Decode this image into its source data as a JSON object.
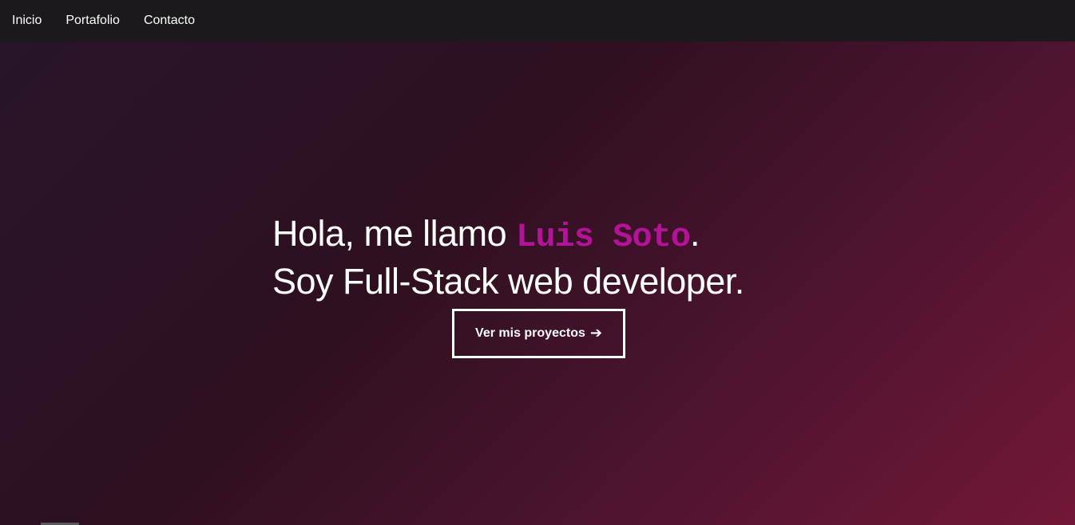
{
  "nav": {
    "items": [
      {
        "label": "Inicio"
      },
      {
        "label": "Portafolio"
      },
      {
        "label": "Contacto"
      }
    ]
  },
  "hero": {
    "line1_prefix": "Hola, me llamo ",
    "name": "Luis Soto",
    "line1_suffix": ".",
    "line2": "Soy Full-Stack web developer.",
    "cta_label": "Ver mis proyectos",
    "cta_icon": "right-arrow-icon"
  },
  "colors": {
    "nav_background": "#1b191b",
    "name_accent": "#b5129a",
    "gradient_start": "#28152a",
    "gradient_end": "#721737"
  }
}
